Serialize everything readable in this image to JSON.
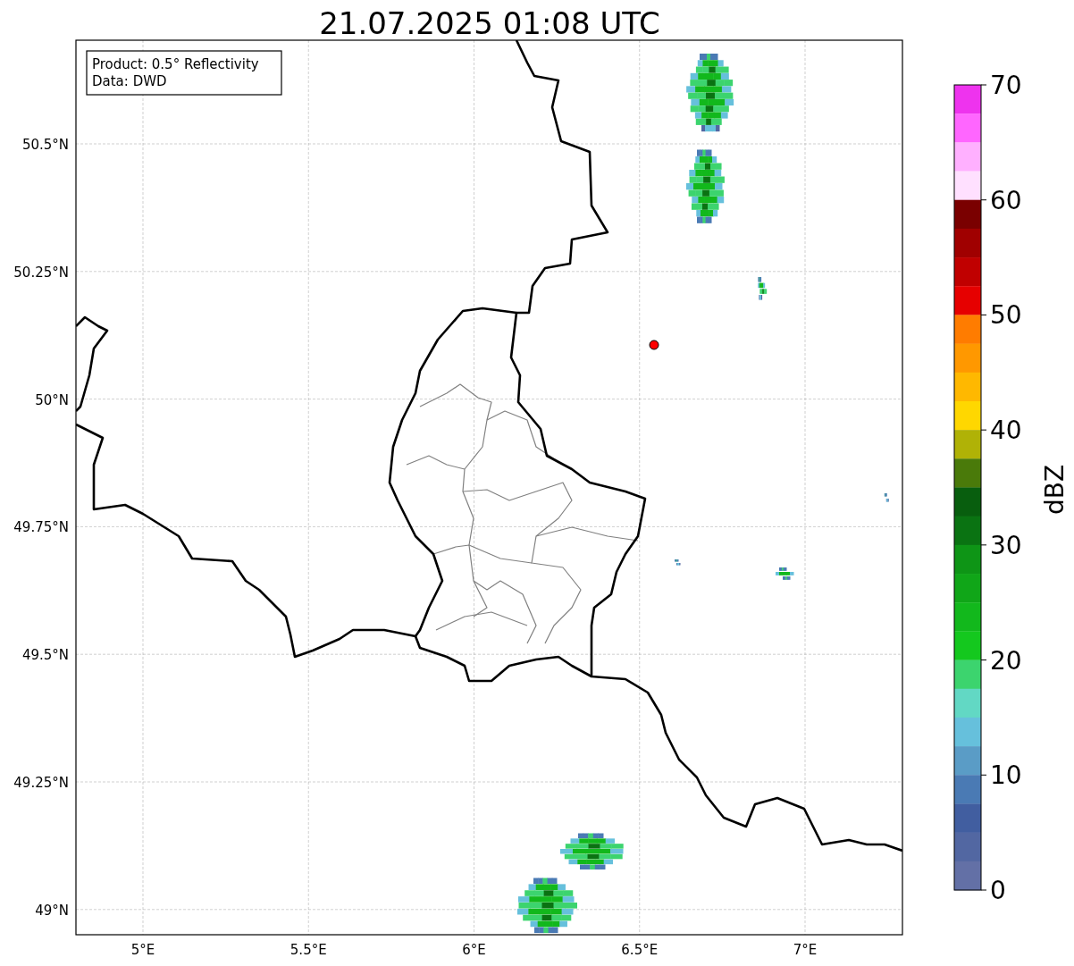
{
  "title": "21.07.2025 01:08 UTC",
  "info_box": [
    "Product: 0.5° Reflectivity",
    "Data: DWD"
  ],
  "map": {
    "lon_ticks": [
      "5°E",
      "5.5°E",
      "6°E",
      "6.5°E",
      "7°E"
    ],
    "lat_ticks": [
      "50.5°N",
      "50.25°N",
      "50°N",
      "49.75°N",
      "49.5°N",
      "49.25°N",
      "49°N"
    ]
  },
  "colorbar": {
    "label": "dBZ",
    "ticks": [
      "70",
      "60",
      "50",
      "40",
      "30",
      "20",
      "10",
      "0"
    ],
    "bins": [
      {
        "color": "#ee33ee"
      },
      {
        "color": "#ff66ff"
      },
      {
        "color": "#ffb0ff"
      },
      {
        "color": "#ffe0ff"
      },
      {
        "color": "#7a0000"
      },
      {
        "color": "#a00000"
      },
      {
        "color": "#c00000"
      },
      {
        "color": "#e60000"
      },
      {
        "color": "#ff7c00"
      },
      {
        "color": "#ff9800"
      },
      {
        "color": "#ffb800"
      },
      {
        "color": "#ffd700"
      },
      {
        "color": "#b0b206"
      },
      {
        "color": "#4a7a0a"
      },
      {
        "color": "#085e0e"
      },
      {
        "color": "#0a7312"
      },
      {
        "color": "#0e9516"
      },
      {
        "color": "#10a618"
      },
      {
        "color": "#12b81c"
      },
      {
        "color": "#14c81e"
      },
      {
        "color": "#3cd46e"
      },
      {
        "color": "#62d8c4"
      },
      {
        "color": "#66c0dc"
      },
      {
        "color": "#5a9cc6"
      },
      {
        "color": "#4a7ab4"
      },
      {
        "color": "#415ea0"
      },
      {
        "color": "#5267a2"
      },
      {
        "color": "#6370a6"
      }
    ]
  }
}
